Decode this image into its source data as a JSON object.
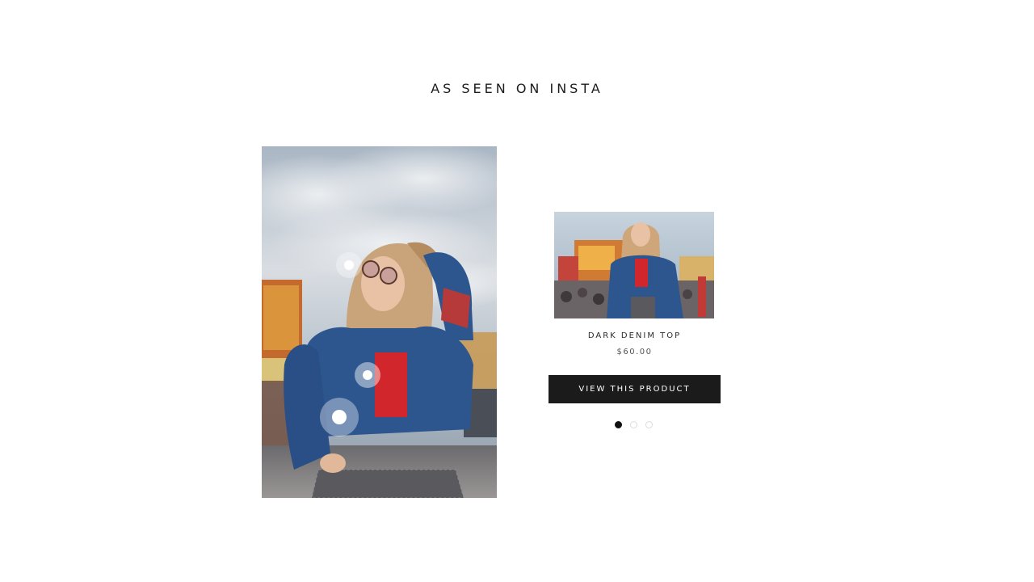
{
  "section": {
    "title": "AS SEEN ON INSTA"
  },
  "lookbook": {
    "hotspots": [
      {
        "name": "sunglasses"
      },
      {
        "name": "top"
      },
      {
        "name": "jacket"
      }
    ]
  },
  "product": {
    "name": "DARK DENIM TOP",
    "price": "$60.00",
    "button_label": "VIEW THIS PRODUCT"
  },
  "pagination": {
    "count": 3,
    "active_index": 0
  },
  "colors": {
    "button_bg": "#1b1b1b",
    "button_text": "#ffffff",
    "title_text": "#1c1c1c",
    "pager_active": "#111111",
    "pager_inactive": "#dcdcdc"
  }
}
